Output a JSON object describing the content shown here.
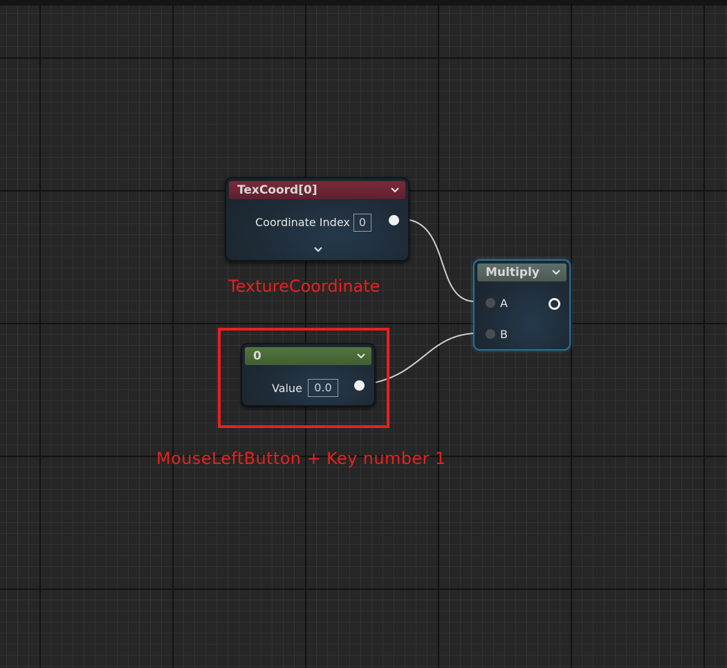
{
  "nodes": {
    "texcoord": {
      "title": "TexCoord[0]",
      "header_color": "#6e2531",
      "input_label": "Coordinate Index",
      "input_value": "0"
    },
    "multiply": {
      "title": "Multiply",
      "header_color": "#55655f",
      "input_a": "A",
      "input_b": "B"
    },
    "constant": {
      "title": "0",
      "header_color": "#4a6a3a",
      "input_label": "Value",
      "input_value": "0.0"
    }
  },
  "annotations": {
    "texcoord_caption": "TextureCoordinate",
    "constant_caption": "MouseLeftButton + Key number 1",
    "color": "#e8201f"
  },
  "icons": [
    "chevron-down-icon",
    "expand-chevron-icon",
    "output-pin-icon",
    "input-pin-icon"
  ]
}
